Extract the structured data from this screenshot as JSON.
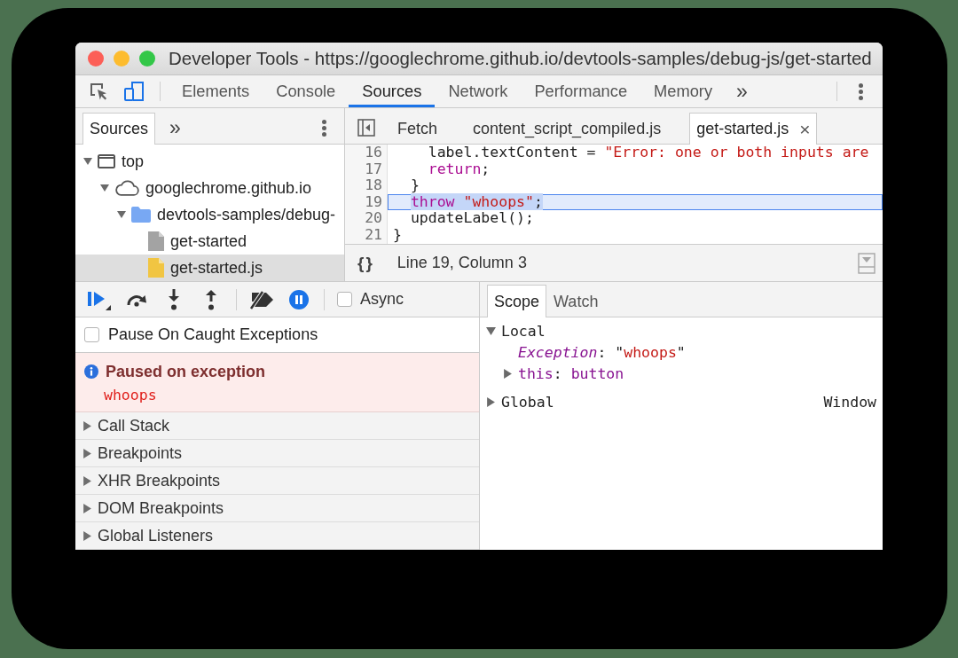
{
  "window": {
    "title": "Developer Tools - https://googlechrome.github.io/devtools-samples/debug-js/get-started"
  },
  "toolbar": {
    "inspect": {
      "on": false
    },
    "device_mode": {
      "on": true
    },
    "tabs": [
      {
        "label": "Elements",
        "selected": false
      },
      {
        "label": "Console",
        "selected": false
      },
      {
        "label": "Sources",
        "selected": true
      },
      {
        "label": "Network",
        "selected": false
      },
      {
        "label": "Performance",
        "selected": false
      },
      {
        "label": "Memory",
        "selected": false
      }
    ],
    "more": "»"
  },
  "navigator": {
    "tabs": [
      {
        "label": "Sources",
        "selected": true
      }
    ],
    "more": "»",
    "tree": [
      {
        "label": "top",
        "kind": "frame",
        "expanded": true,
        "selected": false,
        "children": [
          {
            "label": "googlechrome.github.io",
            "kind": "domain",
            "expanded": true,
            "selected": false,
            "children": [
              {
                "label": "devtools-samples/debug-",
                "kind": "folder",
                "expanded": true,
                "selected": false,
                "children": [
                  {
                    "label": "get-started",
                    "kind": "document",
                    "selected": false
                  },
                  {
                    "label": "get-started.js",
                    "kind": "script",
                    "selected": true
                  }
                ]
              }
            ]
          }
        ]
      }
    ]
  },
  "editor": {
    "tabs": [
      {
        "label": "Fetch",
        "selected": false
      },
      {
        "label": "content_script_compiled.js",
        "selected": false
      },
      {
        "label": "get-started.js",
        "selected": true,
        "close": "×"
      }
    ],
    "lines": [
      {
        "number": "16",
        "current": false,
        "tokens": [
          {
            "text": "    label.textContent = ",
            "kind": "plain",
            "selected": false
          },
          {
            "text": "\"Error: one or both inputs are",
            "kind": "string",
            "selected": false
          }
        ]
      },
      {
        "number": "17",
        "current": false,
        "tokens": [
          {
            "text": "    return",
            "kind": "keyword",
            "selected": false
          },
          {
            "text": ";",
            "kind": "plain",
            "selected": false
          }
        ]
      },
      {
        "number": "18",
        "current": false,
        "tokens": [
          {
            "text": "  }",
            "kind": "plain",
            "selected": false
          }
        ]
      },
      {
        "number": "19",
        "current": true,
        "tokens": [
          {
            "text": "  throw",
            "kind": "keyword",
            "selected": true
          },
          {
            "text": " \"whoops\"",
            "kind": "string",
            "selected": true
          },
          {
            "text": ";",
            "kind": "plain",
            "selected": true
          }
        ]
      },
      {
        "number": "20",
        "current": false,
        "tokens": [
          {
            "text": "  updateLabel();",
            "kind": "plain",
            "selected": false
          }
        ]
      },
      {
        "number": "21",
        "current": false,
        "tokens": [
          {
            "text": "}",
            "kind": "plain",
            "selected": false
          }
        ]
      }
    ],
    "format": "{}",
    "cursor": "Line 19, Column 3"
  },
  "debugger": {
    "controls": [
      {
        "kind": "resume",
        "on": true
      },
      {
        "kind": "step-over",
        "on": false
      },
      {
        "kind": "step-into",
        "on": false
      },
      {
        "kind": "step-out",
        "on": false
      },
      {
        "kind": "deactivate-breakpoints",
        "on": false
      },
      {
        "kind": "pause-on-exceptions",
        "on": true
      }
    ],
    "async": {
      "label": "Async",
      "checked": false
    },
    "pause_on_caught": {
      "label": "Pause On Caught Exceptions",
      "checked": false
    },
    "paused": {
      "title": "Paused on exception",
      "detail": "whoops"
    },
    "sections": [
      {
        "label": "Call Stack",
        "expanded": false
      },
      {
        "label": "Breakpoints",
        "expanded": false
      },
      {
        "label": "XHR Breakpoints",
        "expanded": false
      },
      {
        "label": "DOM Breakpoints",
        "expanded": false
      },
      {
        "label": "Global Listeners",
        "expanded": false
      }
    ]
  },
  "scope": {
    "tabs": [
      {
        "label": "Scope",
        "selected": true
      },
      {
        "label": "Watch",
        "selected": false
      }
    ],
    "tree": [
      {
        "label": "Local",
        "expanded": true,
        "children": [
          {
            "kind": "value",
            "tokens": [
              {
                "text": "Exception",
                "kind": "special"
              },
              {
                "text": ": ",
                "kind": "punct"
              },
              {
                "text": "\"",
                "kind": "punct"
              },
              {
                "text": "whoops",
                "kind": "string"
              },
              {
                "text": "\"",
                "kind": "punct"
              }
            ]
          },
          {
            "kind": "object",
            "expanded": false,
            "tokens": [
              {
                "text": "this",
                "kind": "name"
              },
              {
                "text": ": ",
                "kind": "punct"
              },
              {
                "text": "button",
                "kind": "name"
              }
            ]
          }
        ]
      },
      {
        "label": "Global",
        "expanded": false,
        "value": "Window"
      }
    ]
  }
}
